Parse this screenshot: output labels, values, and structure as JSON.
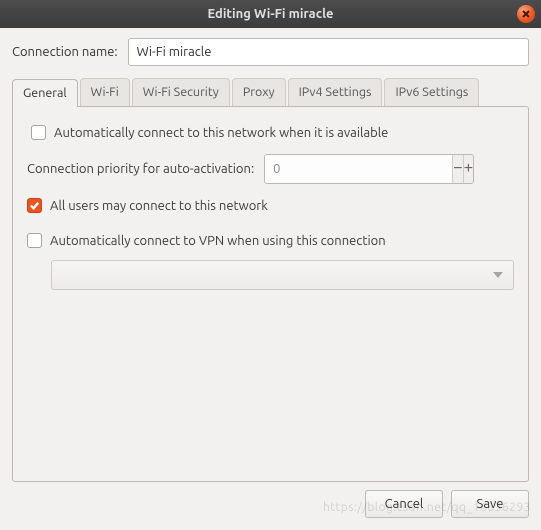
{
  "window": {
    "title": "Editing Wi-Fi miracle"
  },
  "name_row": {
    "label": "Connection name:",
    "value": "Wi-Fi miracle"
  },
  "tabs": {
    "general": "General",
    "wifi": "Wi-Fi",
    "wifi_security": "Wi-Fi Security",
    "proxy": "Proxy",
    "ipv4": "IPv4 Settings",
    "ipv6": "IPv6 Settings"
  },
  "general": {
    "auto_connect_label": "Automatically connect to this network when it is available",
    "auto_connect_checked": false,
    "priority_label": "Connection priority for auto-activation:",
    "priority_value": "0",
    "all_users_label": "All users may connect to this network",
    "all_users_checked": true,
    "auto_vpn_label": "Automatically connect to VPN when using this connection",
    "auto_vpn_checked": false
  },
  "footer": {
    "cancel": "Cancel",
    "save": "Save"
  },
  "watermark": "https://blog.csdn.net/qq_16836293"
}
